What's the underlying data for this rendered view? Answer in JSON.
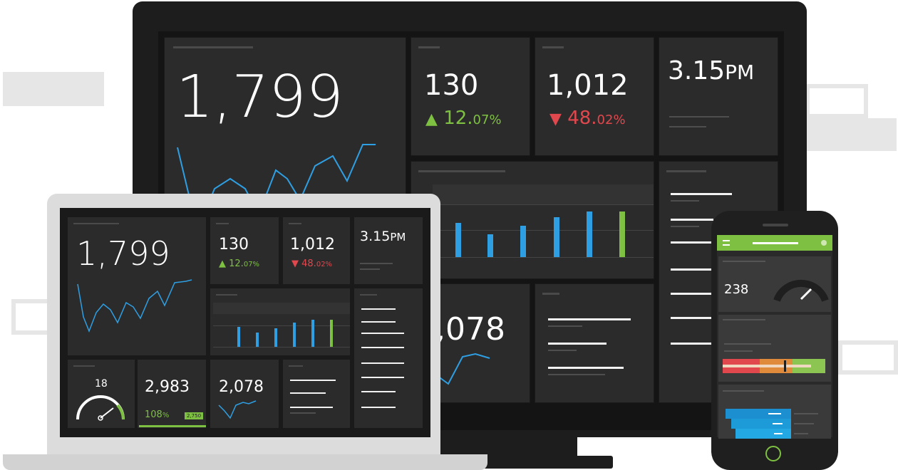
{
  "monitor": {
    "big_number": "1,799",
    "kpi1": {
      "value": "130",
      "trend": "▲",
      "change_main": "12.",
      "change_small": "07%"
    },
    "kpi2": {
      "value": "1,012",
      "trend": "▼",
      "change_main": "48.",
      "change_small": "02%"
    },
    "time": {
      "value": "3.15",
      "suffix": "PM"
    },
    "number_bottom": ",078"
  },
  "laptop": {
    "big_number": "1,799",
    "kpi1": {
      "value": "130",
      "trend": "▲",
      "change_main": "12.",
      "change_small": "07%"
    },
    "kpi2": {
      "value": "1,012",
      "trend": "▼",
      "change_main": "48.",
      "change_small": "02%"
    },
    "time": {
      "value": "3.15",
      "suffix": "PM"
    },
    "gauge": {
      "value": "18"
    },
    "goal": {
      "value": "2,983",
      "percent_main": "108",
      "percent_small": "%",
      "target": "2,750"
    },
    "sparkline": {
      "value": "2,078"
    }
  },
  "phone": {
    "gauge_value": "238"
  },
  "colors": {
    "accent_green": "#7ec142",
    "accent_red": "#e0484e",
    "accent_blue": "#2f9fe3"
  }
}
